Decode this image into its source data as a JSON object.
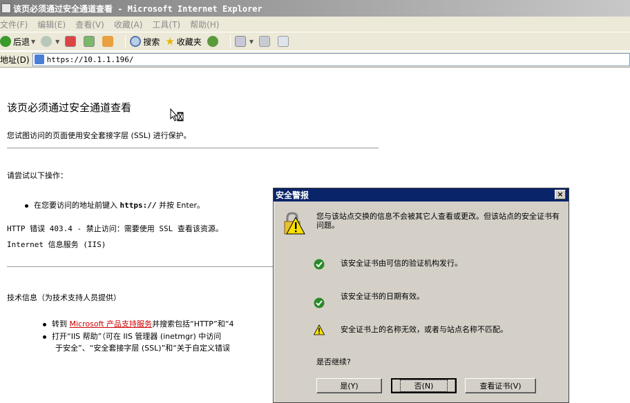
{
  "window": {
    "title": "该页必须通过安全通道查看 - Microsoft Internet Explorer"
  },
  "menu": [
    "文件(F)",
    "编辑(E)",
    "查看(V)",
    "收藏(A)",
    "工具(T)",
    "帮助(H)"
  ],
  "toolbar": {
    "back": "后退",
    "search": "搜索",
    "favorites": "收藏夹"
  },
  "address": {
    "label": "地址(D)",
    "url": "https://10.1.1.196/"
  },
  "page": {
    "title": "该页必须通过安全通道查看",
    "subtitle": "您试图访问的页面使用安全套接字层 (SSL) 进行保护。",
    "try_heading": "请尝试以下操作：",
    "bullet1_pre": "在您要访问的地址前键入",
    "bullet1_code": "https://",
    "bullet1_post": "并按 Enter。",
    "error_line1": "HTTP 错误 403.4 - 禁止访问：需要使用 SSL 查看该资源。",
    "error_line2": "Internet 信息服务 (IIS)",
    "tech_heading": "技术信息（为技术支持人员提供）",
    "bullet2_pre": "转到",
    "bullet2_link": "Microsoft 产品支持服务",
    "bullet2_post": "并搜索包括“HTTP”和“4",
    "bullet3_line1": "打开“IIS 帮助”（可在 IIS 管理器 (inetmgr) 中访问",
    "bullet3_line2": "于安全”、“安全套接字层 (SSL)”和“关于自定义错误"
  },
  "dialog": {
    "title": "安全警报",
    "close": "×",
    "message": "您与该站点交换的信息不会被其它人查看或更改。但该站点的安全证书有问题。",
    "check1": "该安全证书由可信的验证机构发行。",
    "check2": "该安全证书的日期有效。",
    "check3": "安全证书上的名称无效，或者与站点名称不匹配。",
    "question": "是否继续?",
    "yes": "是(Y)",
    "no": "否(N)",
    "view_cert": "查看证书(V)"
  }
}
